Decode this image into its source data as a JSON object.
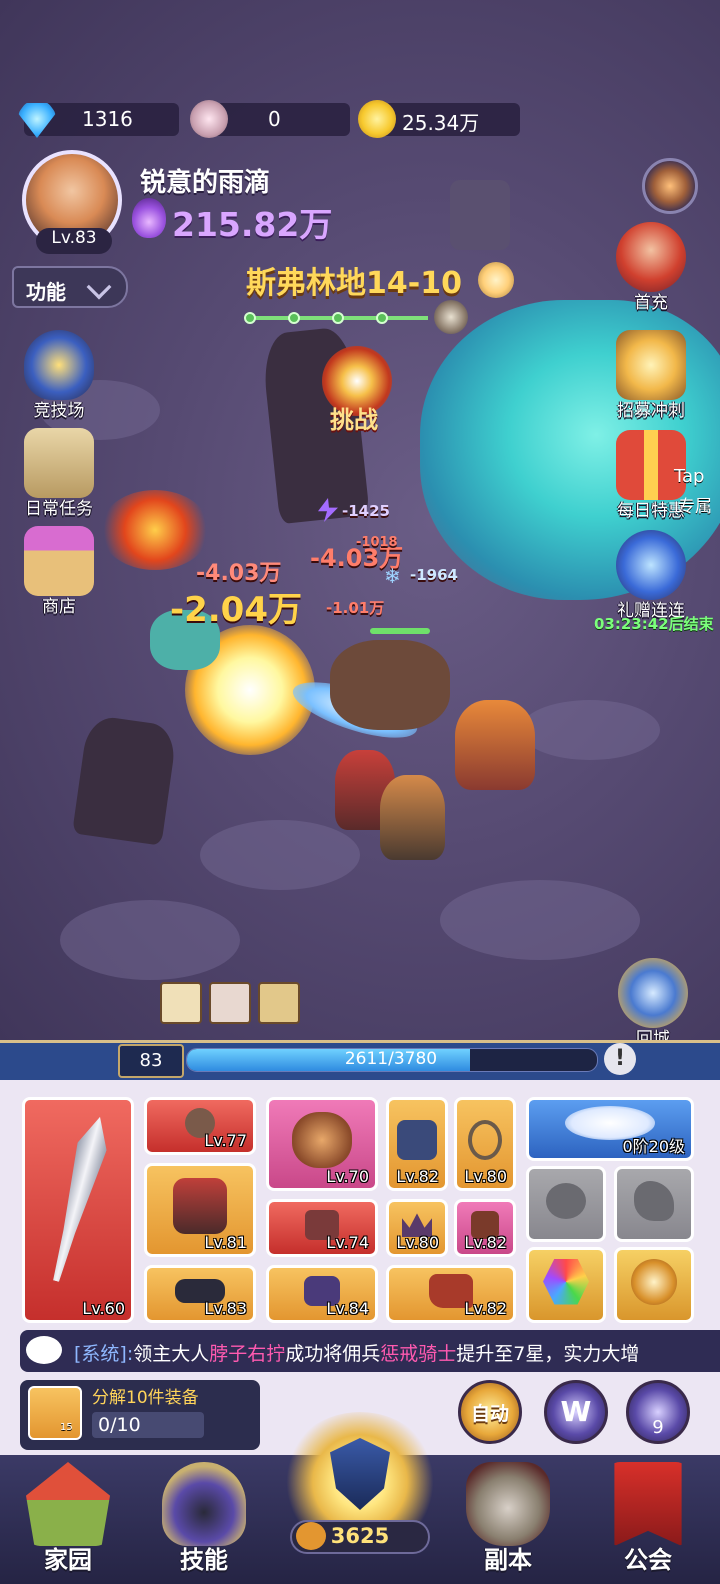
{
  "currencies": {
    "diamonds": "1316",
    "tickets": "0",
    "gold": "25.34万"
  },
  "player": {
    "name": "锐意的雨滴",
    "level": "Lv.83",
    "power": "215.82万"
  },
  "function_menu": {
    "label": "功能"
  },
  "left_menu": [
    {
      "label": "竞技场",
      "icon": "shield-icon"
    },
    {
      "label": "日常任务",
      "icon": "scroll-icon"
    },
    {
      "label": "商店",
      "icon": "shop-icon"
    }
  ],
  "right_menu": [
    {
      "label": "首充",
      "icon": "hero-portrait-icon"
    },
    {
      "label": "招募冲刺",
      "icon": "trophy-icon"
    },
    {
      "label": "每日特惠",
      "icon": "gift-box-icon"
    },
    {
      "label": "礼赠连连",
      "icon": "gift-bag-icon"
    },
    {
      "label": "回城",
      "icon": "portal-icon"
    }
  ],
  "right_menu_extra": {
    "tap_label": "Tap",
    "exclusive_label": "专属",
    "timer": "03:23:42后结束"
  },
  "stage": {
    "title": "斯弗林地14-10",
    "challenge_label": "挑战"
  },
  "damage_numbers": [
    "-4.03万",
    "-4.03万",
    "-2.04万",
    "-1.01万",
    "-1425",
    "-1018",
    "-1964"
  ],
  "xp": {
    "level": "83",
    "text": "2611/3780",
    "current": 2611,
    "max": 3780
  },
  "equipment": [
    {
      "slot": "weapon",
      "level": "Lv.60",
      "rarity": "red",
      "icon": "sword-icon"
    },
    {
      "slot": "ring",
      "level": "Lv.77",
      "rarity": "red",
      "icon": "horn-icon"
    },
    {
      "slot": "pet",
      "level": "Lv.70",
      "rarity": "pink",
      "icon": "lion-icon"
    },
    {
      "slot": "pants",
      "level": "Lv.82",
      "rarity": "orange",
      "icon": "pants-icon"
    },
    {
      "slot": "necklace",
      "level": "Lv.80",
      "rarity": "orange",
      "icon": "necklace-icon"
    },
    {
      "slot": "armor",
      "level": "Lv.81",
      "rarity": "orange",
      "icon": "armor-icon"
    },
    {
      "slot": "bracer",
      "level": "Lv.74",
      "rarity": "red",
      "icon": "bracer-icon"
    },
    {
      "slot": "crown",
      "level": "Lv.80",
      "rarity": "orange",
      "icon": "crown-icon"
    },
    {
      "slot": "glove",
      "level": "Lv.82",
      "rarity": "pink",
      "icon": "glove-icon"
    },
    {
      "slot": "belt",
      "level": "Lv.83",
      "rarity": "orange",
      "icon": "belt-icon"
    },
    {
      "slot": "gauntlet",
      "level": "Lv.84",
      "rarity": "orange",
      "icon": "gauntlet-icon"
    },
    {
      "slot": "boots",
      "level": "Lv.82",
      "rarity": "orange",
      "icon": "boots-icon"
    }
  ],
  "wings": {
    "label": "0阶20级",
    "icon": "wings-icon"
  },
  "locked_slots": [
    {
      "icon": "paw-icon"
    },
    {
      "icon": "horse-icon"
    }
  ],
  "special_slots": [
    {
      "icon": "gem-icon"
    },
    {
      "icon": "sun-emblem-icon"
    }
  ],
  "system_message": {
    "prefix": "[系统]:",
    "text1": "领主大人",
    "player": "脖子右拧",
    "text2": "成功将佣兵",
    "unit": "惩戒骑士",
    "text3": "提升至7星，实力大增"
  },
  "decompose": {
    "title": "分解10件装备",
    "count": "0/10",
    "bread_badge": "15"
  },
  "controls": {
    "auto_label": "自动",
    "w_label": "W",
    "speed_badge": "9"
  },
  "bottom_nav": [
    {
      "label": "家园",
      "icon": "house-icon"
    },
    {
      "label": "技能",
      "icon": "hood-icon"
    },
    {
      "label": "副本",
      "icon": "skull-helmet-icon"
    },
    {
      "label": "公会",
      "icon": "banner-icon"
    }
  ],
  "center": {
    "count": "3625",
    "icon": "shield-badge-icon"
  },
  "colors": {
    "accent_gold": "#ffd85a",
    "power_purple": "#d9a6ff",
    "panel_bg": "#ece6f3",
    "xp_blue": "#2f8be0",
    "timer_green": "#7cff7c"
  }
}
